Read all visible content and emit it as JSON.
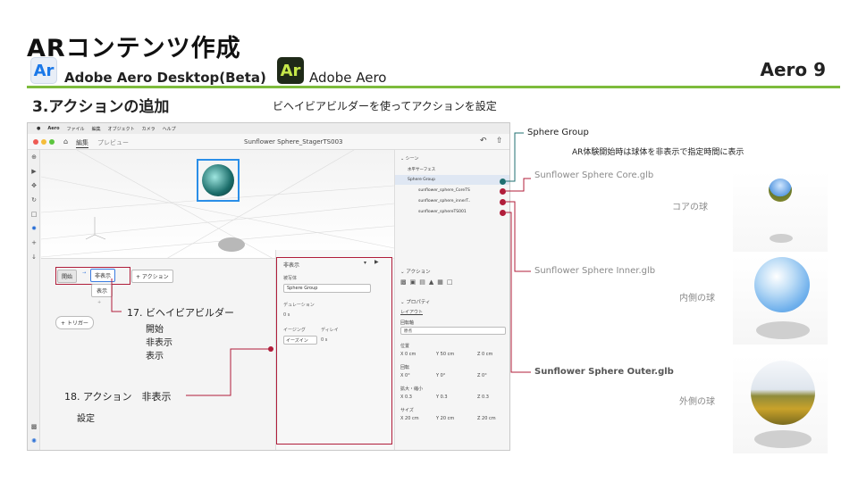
{
  "slide": {
    "title": "ARコンテンツ作成",
    "apps": [
      {
        "badge": "Ar",
        "name": "Adobe Aero Desktop(Beta)"
      },
      {
        "badge": "Ar",
        "name": "Adobe Aero"
      }
    ],
    "aero_number": "Aero 9",
    "section_title": "3.アクションの追加",
    "section_subtitle": "ビヘイビアビルダーを使ってアクションを設定"
  },
  "app": {
    "menubar": [
      "Aero",
      "ファイル",
      "編集",
      "オブジェクト",
      "カメラ",
      "ヘルプ"
    ],
    "tabs": {
      "edit": "編集",
      "preview": "プレビュー"
    },
    "window_title": "Sunflower Sphere_StagerTS003",
    "behavior": {
      "start": "開始",
      "hide_action": "非表示",
      "show_option": "表示",
      "add_action": "+ アクション",
      "plus": "+",
      "trigger": "+ トリガー"
    },
    "inspector": {
      "action_name": "非表示",
      "target_label": "被写体",
      "target_value": "Sphere Group",
      "duration_label": "デュレーション",
      "duration_value": "0 s",
      "easing_label": "イージング",
      "easing_value": "イーズイン",
      "delay_label": "ディレイ",
      "delay_value": "0 s"
    },
    "scene_panel": {
      "header": "シーン",
      "items": [
        "水平サーフェス",
        "Sphere Group",
        "sunflower_sphere_CoreTS",
        "sunflower_sphere_innerT..",
        "sunflower_sphereTS001"
      ]
    },
    "action_panel": {
      "header": "アクション"
    },
    "property_panel": {
      "header": "プロパティ",
      "layout": "レイアウト",
      "pivot_label": "回転軸",
      "pivot_value": "原点",
      "position_label": "位置",
      "position": [
        "X 0 cm",
        "Y 50 cm",
        "Z 0 cm"
      ],
      "rotation_label": "回転",
      "rotation": [
        "X 0°",
        "Y 0°",
        "Z 0°"
      ],
      "scale_label": "拡大・縮小",
      "scale": [
        "X 0.3",
        "Y 0.3",
        "Z 0.3"
      ],
      "size_label": "サイズ",
      "size": [
        "X 20 cm",
        "Y 20 cm",
        "Z 20 cm"
      ]
    }
  },
  "annotations": {
    "sphere_group": "Sphere Group",
    "sphere_group_note": "AR体験開始時は球体を非表示で指定時間に表示",
    "core_file": "Sunflower Sphere Core.glb",
    "core_label": "コアの球",
    "inner_file": "Sunflower Sphere Inner.glb",
    "inner_label": "内側の球",
    "outer_file": "Sunflower Sphere Outer.glb",
    "outer_label": "外側の球",
    "step17": "17. ビヘイビアビルダー",
    "step17_list": [
      "開始",
      "非表示",
      "表示"
    ],
    "step18": "18. アクション　非表示",
    "step18_sub": "設定"
  },
  "colors": {
    "accent_green": "#7dbb3c",
    "callout_red": "#b01d3a",
    "teal": "#1f6f70"
  }
}
